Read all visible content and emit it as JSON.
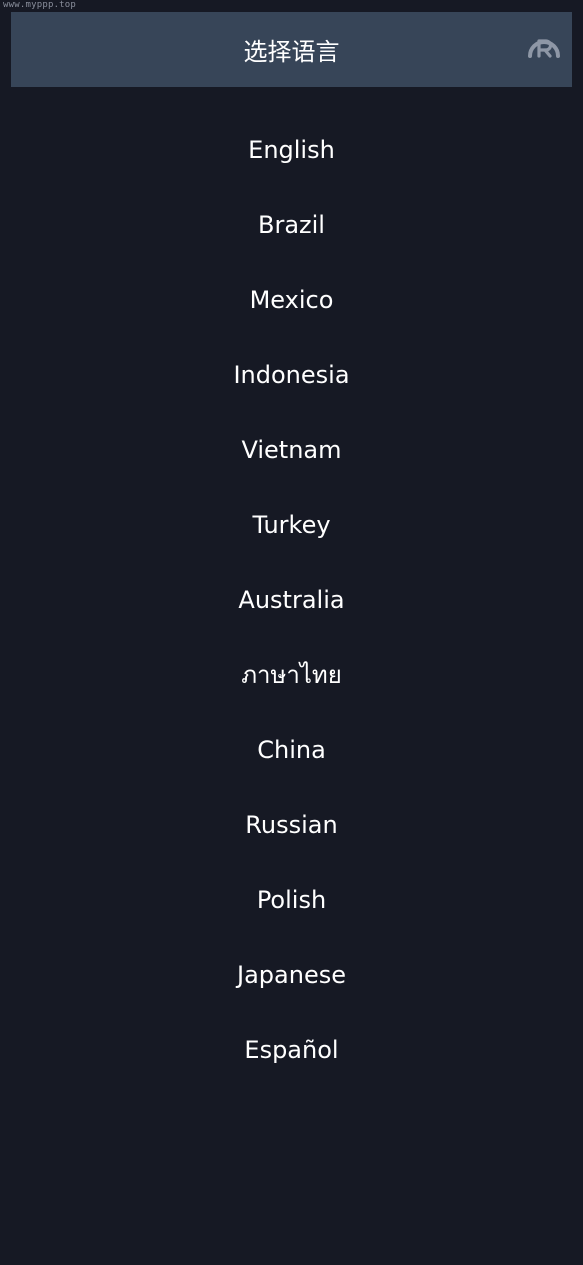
{
  "watermark": "www.myppp.top",
  "header": {
    "title": "选择语言",
    "logo_icon": "registered-logo-icon"
  },
  "languages": [
    {
      "label": "English"
    },
    {
      "label": "Brazil"
    },
    {
      "label": "Mexico"
    },
    {
      "label": "Indonesia"
    },
    {
      "label": "Vietnam"
    },
    {
      "label": "Turkey"
    },
    {
      "label": "Australia"
    },
    {
      "label": "ภาษาไทย"
    },
    {
      "label": "China"
    },
    {
      "label": "Russian"
    },
    {
      "label": "Polish"
    },
    {
      "label": "Japanese"
    },
    {
      "label": "Español"
    }
  ],
  "colors": {
    "background": "#161924",
    "header_bg": "#374558",
    "text": "#ffffff",
    "logo": "#8e97a6"
  }
}
